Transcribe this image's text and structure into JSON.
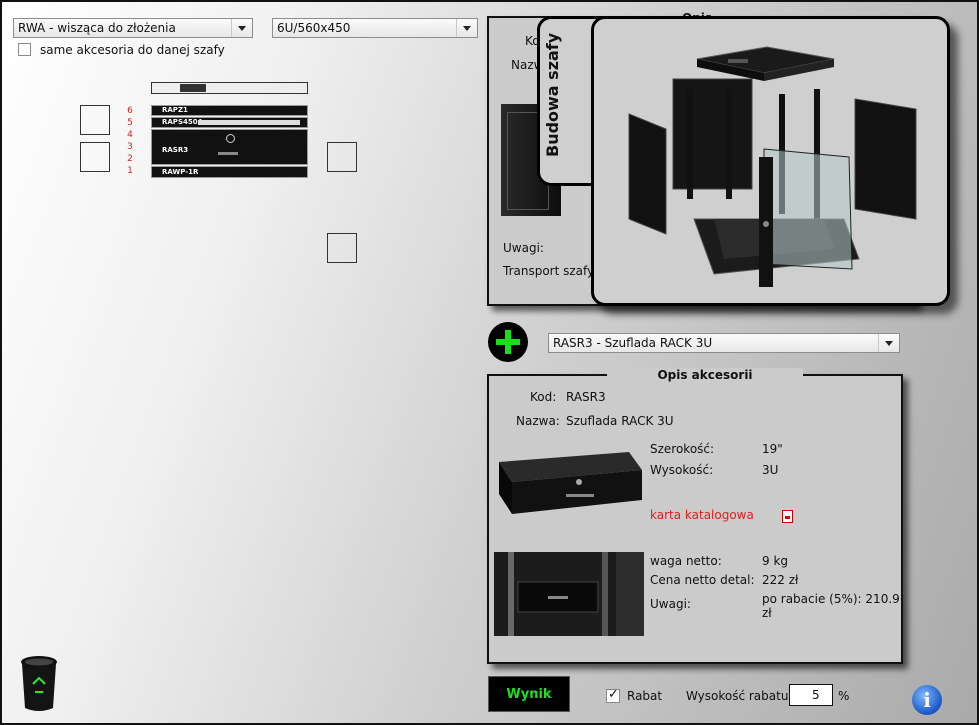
{
  "top": {
    "cabinet_select": "RWA - wisząca do złożenia",
    "size_select": "6U/560x450",
    "only_accessories_label": "same akcesoria do danej szafy"
  },
  "rack": {
    "numbers": [
      "6",
      "5",
      "4",
      "3",
      "2",
      "1"
    ],
    "items": [
      {
        "label": "RAPZ1"
      },
      {
        "label": "RAPS450A"
      },
      {
        "label": "RASR3"
      },
      {
        "label": "RAWP-1R"
      }
    ]
  },
  "opis_panel": {
    "title": "Opis",
    "kod_label": "Ko",
    "nazwa_label": "Nazw",
    "uwagi_label": "Uwagi:",
    "transport_label": "Transport szafy: p"
  },
  "overlay": {
    "tab_label": "Budowa szafy"
  },
  "accessory": {
    "select_value": "RASR3 - Szuflada RACK 3U"
  },
  "accessory_panel": {
    "title": "Opis akcesorii",
    "kod_label": "Kod:",
    "kod_value": "RASR3",
    "nazwa_label": "Nazwa:",
    "nazwa_value": "Szuflada RACK 3U",
    "szerokosc_label": "Szerokość:",
    "szerokosc_value": "19\"",
    "wysokosc_label": "Wysokość:",
    "wysokosc_value": "3U",
    "catalog_link": "karta katalogowa",
    "waga_label": "waga netto:",
    "waga_value": "9 kg",
    "cena_label": "Cena netto detal:",
    "cena_value": "222 zł",
    "uwagi_label": "Uwagi:",
    "rabat_info": "po rabacie (5%): 210.9 zł"
  },
  "bottom": {
    "wynik_label": "Wynik",
    "rabat_label": "Rabat",
    "rabat_checked": true,
    "wysokosc_rabatu_label": "Wysokość rabatu:",
    "rabat_value": "5",
    "percent": "%",
    "info_symbol": "i"
  },
  "colors": {
    "accent_green": "#1ee01e",
    "rack_number_red": "#e02020",
    "link_red": "#e02020"
  }
}
